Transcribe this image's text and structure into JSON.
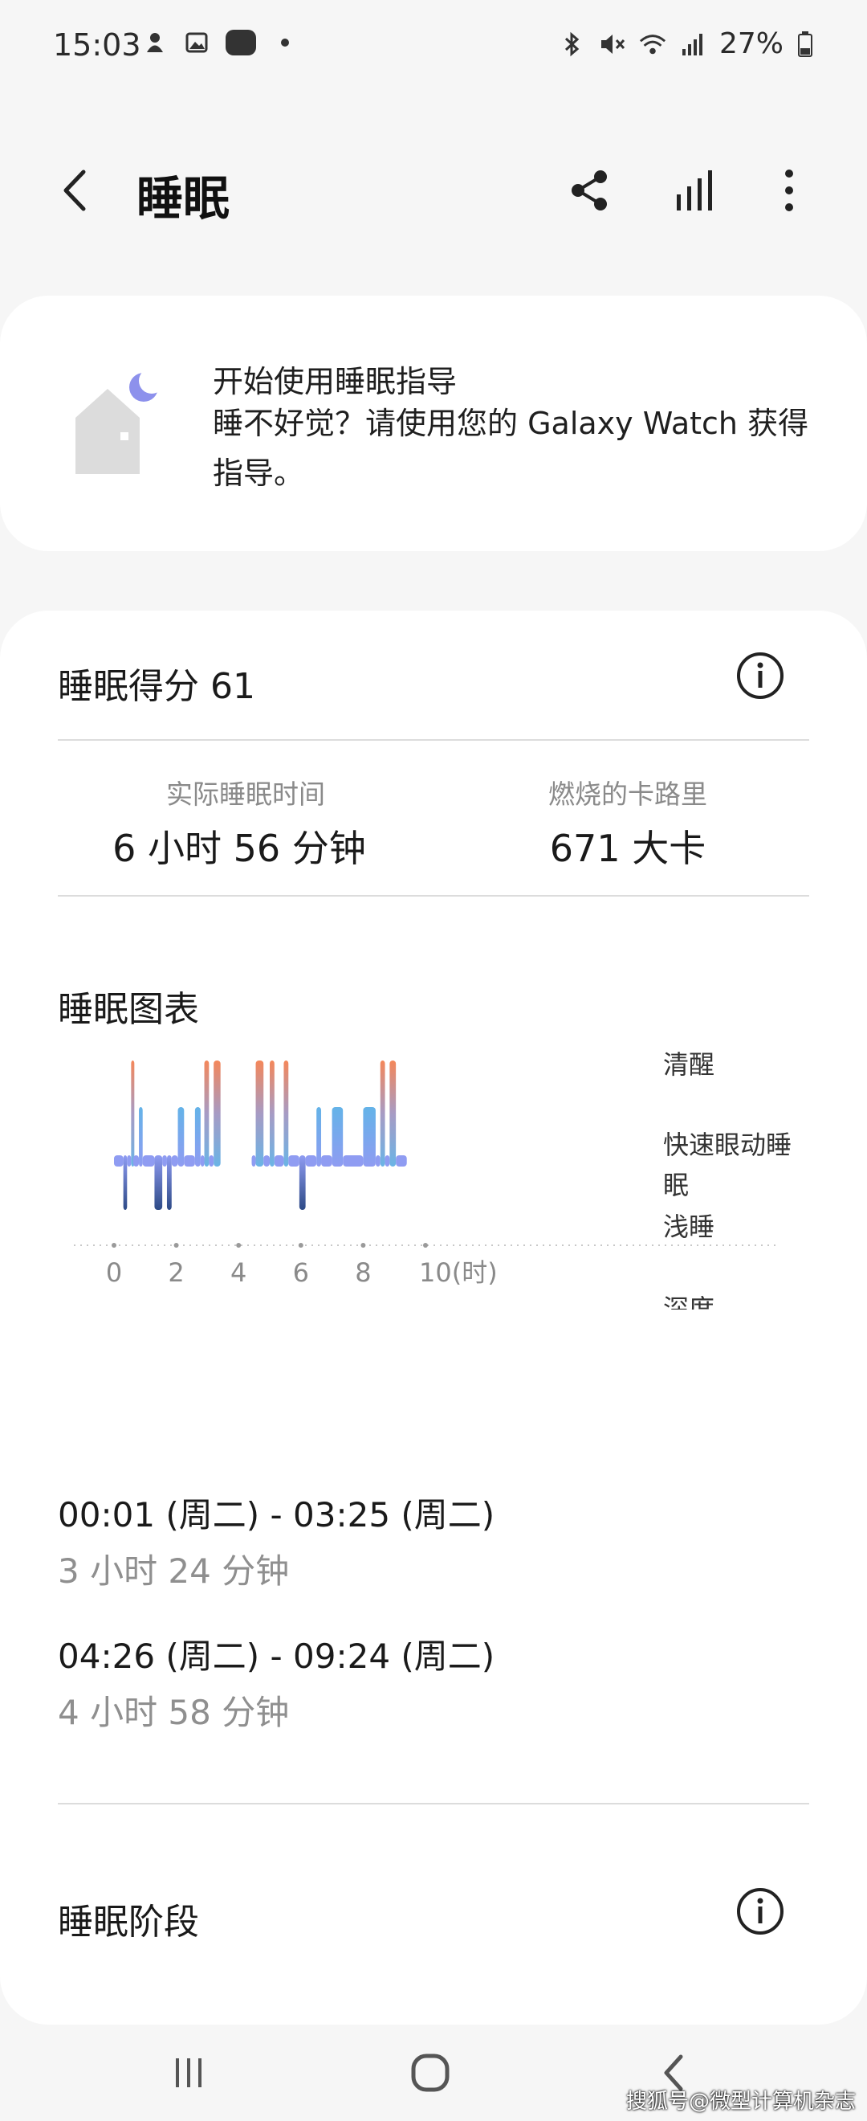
{
  "status_bar": {
    "time": "15:03",
    "left_icons": [
      "notification-icon",
      "gallery-icon",
      "wear-icon",
      "dot-icon"
    ],
    "wear_label": "Wear",
    "right_icons": [
      "bluetooth-icon",
      "mute-icon",
      "wifi-icon",
      "signal-icon",
      "battery-icon"
    ],
    "battery": "27%"
  },
  "app_bar": {
    "title": "睡眠",
    "icons": [
      "back-icon",
      "share-icon",
      "stats-icon",
      "more-icon"
    ]
  },
  "coach_card": {
    "title": "开始使用睡眠指导",
    "description": "睡不好觉？请使用您的 Galaxy Watch 获得指导。"
  },
  "score": {
    "title": "睡眠得分 61",
    "stats": [
      {
        "label": "实际睡眠时间",
        "value": "6 小时 56 分钟"
      },
      {
        "label": "燃烧的卡路里",
        "value": "671 大卡"
      }
    ]
  },
  "chart_section": {
    "title": "睡眠图表"
  },
  "chart_data": {
    "type": "area",
    "xlabel": "",
    "ylabel": "",
    "x_ticks": [
      "0",
      "2",
      "4",
      "6",
      "8",
      "10(时)"
    ],
    "xlim": [
      0,
      10
    ],
    "y_categories": [
      "清醒",
      "快速眼动睡眠",
      "浅睡",
      "深度"
    ],
    "colors": {
      "awake": "#f08a5d",
      "rem": "#6ab4e6",
      "light": "#8f9cf2",
      "deep": "#2f4f8f"
    },
    "segments": [
      {
        "start": 0.0,
        "end": 0.3,
        "stage": "浅睡"
      },
      {
        "start": 0.3,
        "end": 0.42,
        "stage": "深度"
      },
      {
        "start": 0.42,
        "end": 0.55,
        "stage": "浅睡"
      },
      {
        "start": 0.55,
        "end": 0.62,
        "stage": "清醒"
      },
      {
        "start": 0.62,
        "end": 0.8,
        "stage": "浅睡"
      },
      {
        "start": 0.8,
        "end": 0.92,
        "stage": "快速眼动睡眠"
      },
      {
        "start": 0.92,
        "end": 1.3,
        "stage": "浅睡"
      },
      {
        "start": 1.3,
        "end": 1.55,
        "stage": "深度"
      },
      {
        "start": 1.55,
        "end": 1.7,
        "stage": "浅睡"
      },
      {
        "start": 1.7,
        "end": 1.85,
        "stage": "深度"
      },
      {
        "start": 1.85,
        "end": 2.05,
        "stage": "浅睡"
      },
      {
        "start": 2.05,
        "end": 2.25,
        "stage": "快速眼动睡眠"
      },
      {
        "start": 2.25,
        "end": 2.6,
        "stage": "浅睡"
      },
      {
        "start": 2.6,
        "end": 2.78,
        "stage": "快速眼动睡眠"
      },
      {
        "start": 2.78,
        "end": 2.9,
        "stage": "浅睡"
      },
      {
        "start": 2.9,
        "end": 3.05,
        "stage": "清醒"
      },
      {
        "start": 3.05,
        "end": 3.2,
        "stage": "浅睡"
      },
      {
        "start": 3.2,
        "end": 3.42,
        "stage": "清醒"
      },
      {
        "start": 4.42,
        "end": 4.55,
        "stage": "浅睡"
      },
      {
        "start": 4.55,
        "end": 4.8,
        "stage": "清醒"
      },
      {
        "start": 4.8,
        "end": 5.0,
        "stage": "浅睡"
      },
      {
        "start": 5.0,
        "end": 5.15,
        "stage": "清醒"
      },
      {
        "start": 5.15,
        "end": 5.45,
        "stage": "浅睡"
      },
      {
        "start": 5.45,
        "end": 5.6,
        "stage": "清醒"
      },
      {
        "start": 5.6,
        "end": 5.95,
        "stage": "浅睡"
      },
      {
        "start": 5.95,
        "end": 6.15,
        "stage": "深度"
      },
      {
        "start": 6.15,
        "end": 6.5,
        "stage": "浅睡"
      },
      {
        "start": 6.5,
        "end": 6.65,
        "stage": "快速眼动睡眠"
      },
      {
        "start": 6.65,
        "end": 7.0,
        "stage": "浅睡"
      },
      {
        "start": 7.0,
        "end": 7.35,
        "stage": "快速眼动睡眠"
      },
      {
        "start": 7.35,
        "end": 8.0,
        "stage": "浅睡"
      },
      {
        "start": 8.0,
        "end": 8.4,
        "stage": "快速眼动睡眠"
      },
      {
        "start": 8.4,
        "end": 8.55,
        "stage": "浅睡"
      },
      {
        "start": 8.55,
        "end": 8.7,
        "stage": "清醒"
      },
      {
        "start": 8.7,
        "end": 8.85,
        "stage": "浅睡"
      },
      {
        "start": 8.85,
        "end": 9.05,
        "stage": "清醒"
      },
      {
        "start": 9.05,
        "end": 9.4,
        "stage": "浅睡"
      }
    ]
  },
  "sessions": [
    {
      "range": "00:01 (周二) - 03:25 (周二)",
      "duration": "3 小时 24 分钟"
    },
    {
      "range": "04:26 (周二) - 09:24 (周二)",
      "duration": "4 小时 58 分钟"
    }
  ],
  "stages_section": {
    "title": "睡眠阶段"
  },
  "watermark": "搜狐号@微型计算机杂志"
}
